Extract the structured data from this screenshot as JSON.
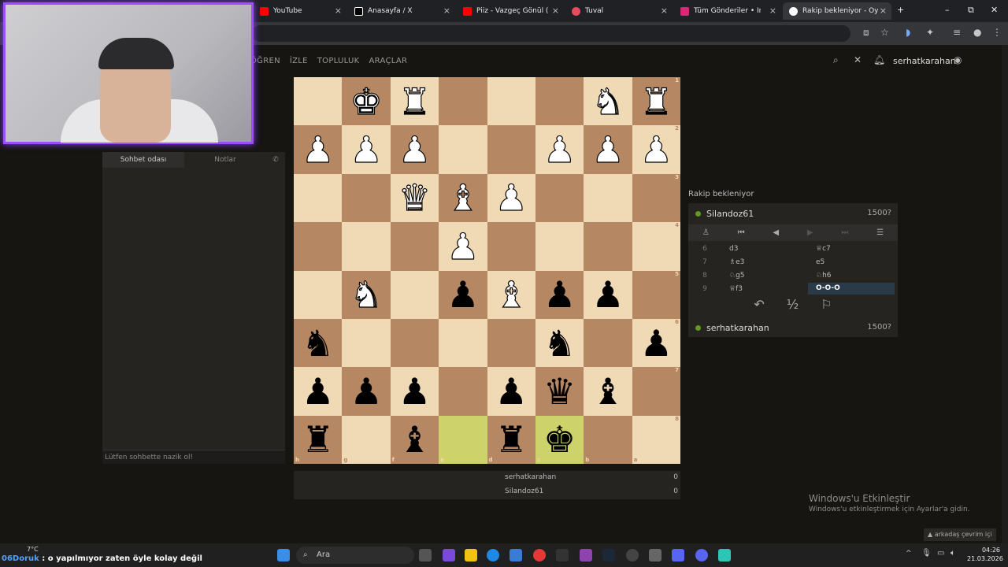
{
  "browser": {
    "tabs": [
      {
        "title": "YouTube",
        "icon": "youtube-icon",
        "color": "#ff0000"
      },
      {
        "title": "Anasayfa / X",
        "icon": "x-icon",
        "color": "#ffffff"
      },
      {
        "title": "Piiz - Vazgeç Gönül (Cove",
        "icon": "youtube-icon",
        "color": "#ff0000"
      },
      {
        "title": "Tuval",
        "icon": "tuval-icon",
        "color": "#e84b5b"
      },
      {
        "title": "Tüm Gönderiler • Insta",
        "icon": "instagram-icon",
        "color": "#d62976"
      },
      {
        "title": "Rakip bekleniyor - Oyna",
        "icon": "lichess-icon",
        "color": "#ffffff"
      }
    ]
  },
  "site": {
    "nav": [
      "ÖĞREN",
      "İZLE",
      "TOPLULUK",
      "ARAÇLAR"
    ],
    "username": "serhatkarahan"
  },
  "chat": {
    "tab_chat": "Sohbet odası",
    "tab_notes": "Notlar",
    "input_placeholder": "Lütfen sohbette nazik ol!"
  },
  "board": {
    "rank_labels": [
      "1",
      "2",
      "3",
      "4",
      "5",
      "6",
      "7",
      "8"
    ],
    "file_labels": [
      "h",
      "g",
      "f",
      "e",
      "d",
      "c",
      "b",
      "a"
    ],
    "rows": [
      [
        "",
        "wK",
        "wR",
        "",
        "",
        "",
        "wN",
        "wR"
      ],
      [
        "wP",
        "wP",
        "wP",
        "",
        "",
        "wP",
        "wP",
        "wP"
      ],
      [
        "",
        "",
        "wQ",
        "wB",
        "wP",
        "",
        "",
        ""
      ],
      [
        "",
        "",
        "",
        "wP",
        "",
        "",
        "",
        ""
      ],
      [
        "",
        "wN",
        "",
        "bP",
        "wB",
        "bP",
        "bP",
        ""
      ],
      [
        "bN",
        "",
        "",
        "",
        "",
        "bN",
        "",
        "bP"
      ],
      [
        "bP",
        "bP",
        "bP",
        "",
        "bP",
        "bQ",
        "bB",
        ""
      ],
      [
        "bR",
        "",
        "bB",
        "",
        "bR",
        "bK",
        "",
        ""
      ]
    ],
    "highlight": [
      [
        7,
        3
      ],
      [
        7,
        5
      ]
    ]
  },
  "score": {
    "rows": [
      {
        "name": "serhatkarahan",
        "score": "0"
      },
      {
        "name": "Silandoz61",
        "score": "0"
      }
    ]
  },
  "game": {
    "status": "Rakip bekleniyor",
    "opponent": {
      "name": "Silandoz61",
      "rating": "1500?"
    },
    "me": {
      "name": "serhatkarahan",
      "rating": "1500?"
    },
    "moves": [
      {
        "no": "6",
        "white": "d3",
        "black": "♕c7"
      },
      {
        "no": "7",
        "white": "♗e3",
        "black": "e5"
      },
      {
        "no": "8",
        "white": "♘g5",
        "black": "♘h6"
      },
      {
        "no": "9",
        "white": "♕f3",
        "black": "O-O-O"
      }
    ],
    "half": "½"
  },
  "windows": {
    "activate_title": "Windows'u Etkinleştir",
    "activate_sub": "Windows'u etkinleştirmek için Ayarlar'a gidin.",
    "friends": "arkadaş çevrim içi"
  },
  "taskbar": {
    "ticker_name": "06Doruk",
    "ticker_text": " : o yapılmıyor zaten öyle kolay değil",
    "temp": "7°C",
    "search": "Ara",
    "time": "04:26",
    "date": "21.03.2026"
  }
}
